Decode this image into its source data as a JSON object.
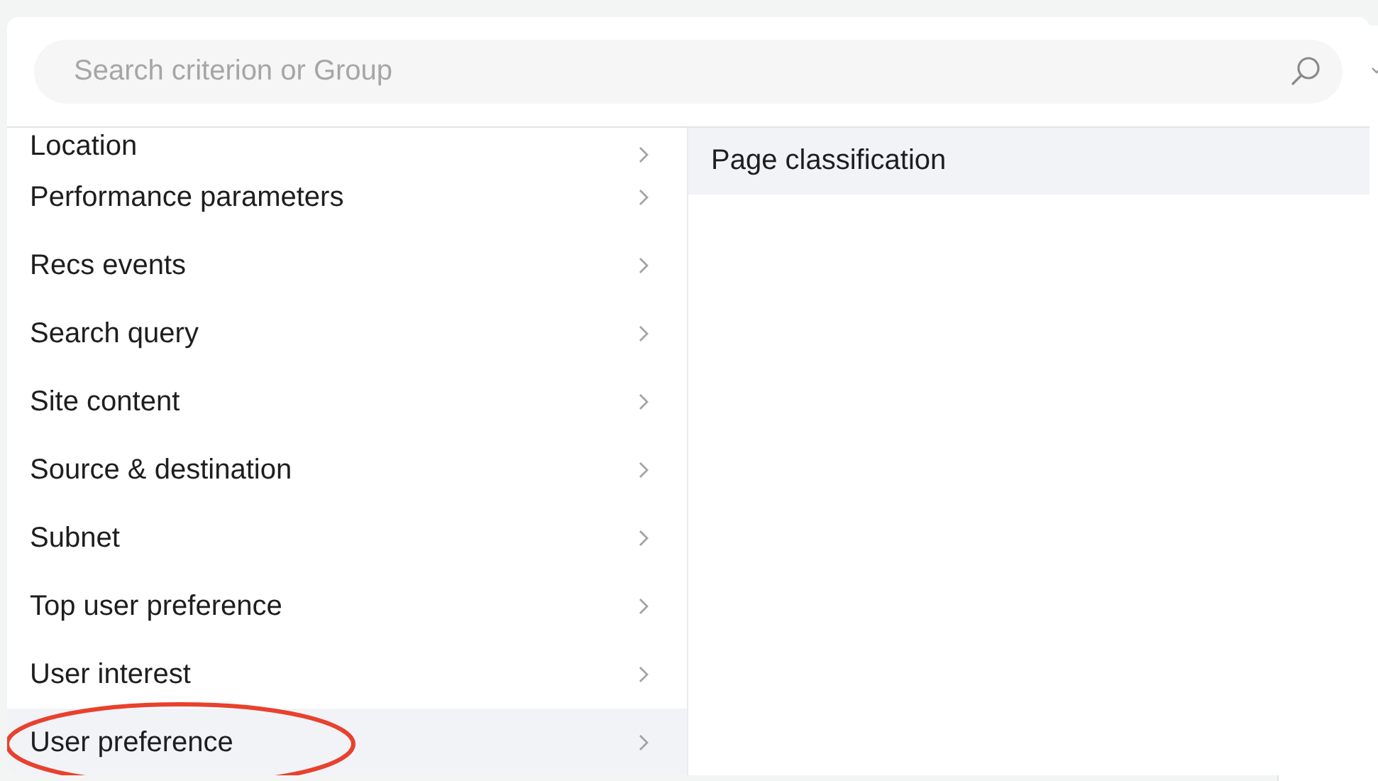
{
  "search": {
    "placeholder": "Search criterion or Group"
  },
  "categories": [
    {
      "label": "Location",
      "selected": false,
      "circled": false
    },
    {
      "label": "Performance parameters",
      "selected": false,
      "circled": false
    },
    {
      "label": "Recs events",
      "selected": false,
      "circled": false
    },
    {
      "label": "Search query",
      "selected": false,
      "circled": false
    },
    {
      "label": "Site content",
      "selected": false,
      "circled": false
    },
    {
      "label": "Source & destination",
      "selected": false,
      "circled": false
    },
    {
      "label": "Subnet",
      "selected": false,
      "circled": false
    },
    {
      "label": "Top user preference",
      "selected": false,
      "circled": false
    },
    {
      "label": "User interest",
      "selected": false,
      "circled": false
    },
    {
      "label": "User preference",
      "selected": true,
      "circled": true
    }
  ],
  "criteria": [
    {
      "label": "Page classification",
      "selected": true
    }
  ]
}
